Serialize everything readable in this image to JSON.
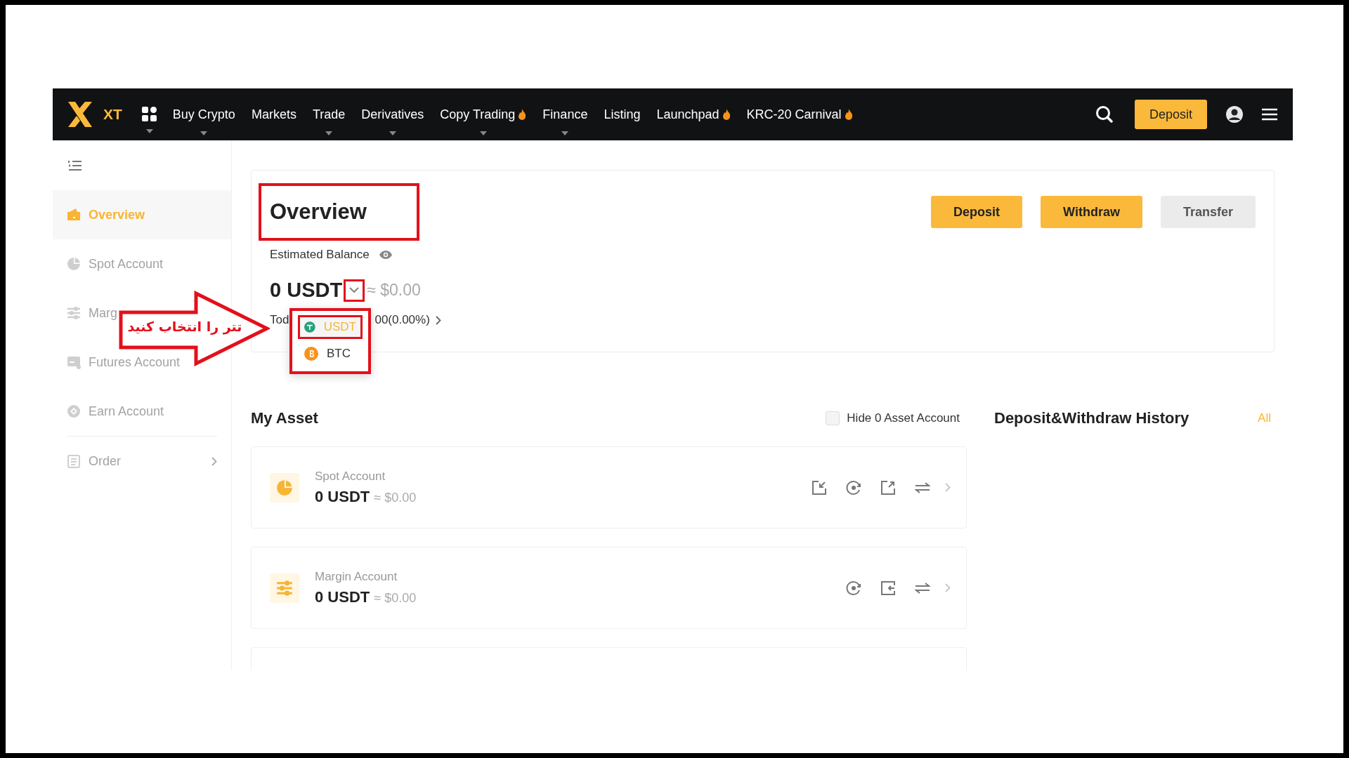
{
  "nav": {
    "logo": "XT",
    "items": [
      {
        "label": "Buy Crypto",
        "dropdown": true,
        "hot": false
      },
      {
        "label": "Markets",
        "dropdown": false,
        "hot": false
      },
      {
        "label": "Trade",
        "dropdown": true,
        "hot": false
      },
      {
        "label": "Derivatives",
        "dropdown": true,
        "hot": false
      },
      {
        "label": "Copy Trading",
        "dropdown": true,
        "hot": true
      },
      {
        "label": "Finance",
        "dropdown": true,
        "hot": false
      },
      {
        "label": "Listing",
        "dropdown": false,
        "hot": false
      },
      {
        "label": "Launchpad",
        "dropdown": false,
        "hot": true
      },
      {
        "label": "KRC-20 Carnival",
        "dropdown": false,
        "hot": true
      }
    ],
    "deposit_button": "Deposit"
  },
  "sidebar": {
    "items": [
      {
        "label": "Overview",
        "kind": "wallet",
        "selected": true,
        "divider_above": false,
        "chevron": false
      },
      {
        "label": "Spot Account",
        "kind": "pie",
        "selected": false,
        "divider_above": false,
        "chevron": false
      },
      {
        "label": "Marg",
        "kind": "sliders",
        "selected": false,
        "divider_above": false,
        "chevron": false
      },
      {
        "label": "Futures Account",
        "kind": "card",
        "selected": false,
        "divider_above": false,
        "chevron": false
      },
      {
        "label": "Earn Account",
        "kind": "coin",
        "selected": false,
        "divider_above": false,
        "chevron": false
      },
      {
        "label": "Order",
        "kind": "list",
        "selected": false,
        "divider_above": true,
        "chevron": true
      }
    ]
  },
  "overview": {
    "title": "Overview",
    "title_highlight": true,
    "buttons": [
      {
        "label": "Deposit",
        "kind": "primary"
      },
      {
        "label": "Withdraw",
        "kind": "primary"
      },
      {
        "label": "Transfer",
        "kind": "secondary"
      }
    ],
    "balance_label": "Estimated Balance",
    "balance": "0 USDT",
    "toggle_highlight": true,
    "balance_fiat": "≈ $0.00",
    "pnl_left": "Tod",
    "pnl_right": "00(0.00%)",
    "menu_highlight": true,
    "currency_menu": [
      {
        "label": "USDT",
        "kind": "tether",
        "selected": true,
        "highlight": true
      },
      {
        "label": "BTC",
        "kind": "bitcoin",
        "selected": false,
        "highlight": false
      }
    ]
  },
  "assets": {
    "title": "My Asset",
    "hide_zero": {
      "label": "Hide 0 Asset Account",
      "checked": false
    },
    "accounts": [
      {
        "name": "Spot Account",
        "kind": "pie",
        "amount": "0 USDT",
        "fiat": "≈ $0.00",
        "actions": [
          {
            "kind": "receive"
          },
          {
            "kind": "target"
          },
          {
            "kind": "send"
          },
          {
            "kind": "transfer"
          }
        ]
      },
      {
        "name": "Margin Account",
        "kind": "sliders",
        "amount": "0 USDT",
        "fiat": "≈ $0.00",
        "actions": [
          {
            "kind": "target"
          },
          {
            "kind": "loan"
          },
          {
            "kind": "transfer"
          }
        ]
      }
    ]
  },
  "history": {
    "title": "Deposit&Withdraw History",
    "all_link": "All"
  },
  "annotation": {
    "text": "تتر را انتخاب کنید"
  }
}
